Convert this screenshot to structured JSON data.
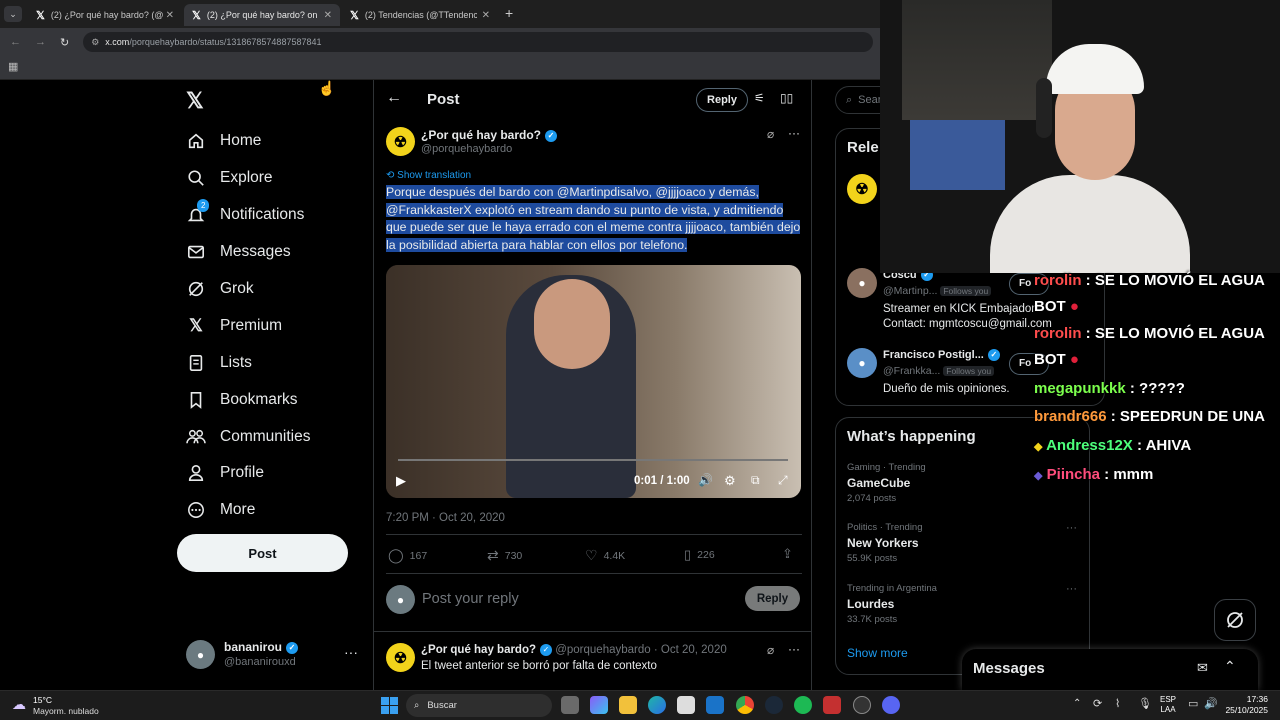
{
  "browser": {
    "tabs": [
      {
        "title": "(2) ¿Por qué hay bardo? (@porq",
        "active": false
      },
      {
        "title": "(2) ¿Por qué hay bardo? on X: \"",
        "active": true
      },
      {
        "title": "(2) Tendencias (@TTendenciaX)",
        "active": false
      }
    ],
    "url_domain": "x.com",
    "url_path": "/porquehaybardo/status/1318678574887587841"
  },
  "nav": {
    "items": [
      {
        "label": "Home",
        "icon": "home-icon"
      },
      {
        "label": "Explore",
        "icon": "search-icon"
      },
      {
        "label": "Notifications",
        "icon": "bell-icon",
        "badge": "2"
      },
      {
        "label": "Messages",
        "icon": "mail-icon"
      },
      {
        "label": "Grok",
        "icon": "grok-icon"
      },
      {
        "label": "Premium",
        "icon": "x-icon"
      },
      {
        "label": "Lists",
        "icon": "list-icon"
      },
      {
        "label": "Bookmarks",
        "icon": "bookmark-icon"
      },
      {
        "label": "Communities",
        "icon": "communities-icon"
      },
      {
        "label": "Profile",
        "icon": "person-icon"
      },
      {
        "label": "More",
        "icon": "more-circle-icon"
      }
    ],
    "post_label": "Post",
    "account": {
      "name": "bananirou",
      "handle": "@bananirouxd"
    }
  },
  "header": {
    "title": "Post",
    "reply_label": "Reply"
  },
  "tweet": {
    "author": "¿Por qué hay bardo?",
    "handle": "@porquehaybardo",
    "show_translation": "Show translation",
    "text": "Porque después del bardo con @Martinpdisalvo, @jjjjoaco y demás, @FrankkasterX explotó en stream dando su punto de vista, y admitiendo que puede ser que le haya errado con el meme contra jjjjoaco, también dejo la posibilidad abierta para hablar con ellos por telefono.",
    "video_time": "0:01 / 1:00",
    "timestamp": "7:20 PM · Oct 20, 2020",
    "stats": {
      "replies": "167",
      "reposts": "730",
      "likes": "4.4K",
      "bookmarks": "226"
    },
    "reply_placeholder": "Post your reply",
    "reply_button": "Reply"
  },
  "reply_tweet": {
    "author": "¿Por qué hay bardo?",
    "handle": "@porquehaybardo",
    "date": "· Oct 20, 2020",
    "text": "El tweet anterior se borró por falta de contexto"
  },
  "right": {
    "search_placeholder": "Sear",
    "relevant_title": "Rele",
    "people": [
      {
        "name": "Coscu",
        "handle": "@Martinp...",
        "follows": "Follows you",
        "follow_btn": "Fo",
        "bio": "Streamer en KICK Embajador",
        "bio2": "Contact: mgmtcoscu@gmail.com"
      },
      {
        "name": "Francisco Postigl...",
        "handle": "@Frankka...",
        "follows": "Follows you",
        "follow_btn": "Fo",
        "bio": "Dueño de mis opiniones."
      }
    ],
    "happening_title": "What’s happening",
    "trends": [
      {
        "category": "Gaming · Trending",
        "name": "GameCube",
        "count": "2,074 posts"
      },
      {
        "category": "Politics · Trending",
        "name": "New Yorkers",
        "count": "55.9K posts"
      },
      {
        "category": "Trending in Argentina",
        "name": "Lourdes",
        "count": "33.7K posts"
      }
    ],
    "show_more": "Show more",
    "messages_label": "Messages"
  },
  "chat": [
    {
      "user": "rorolin",
      "msg": "SE LO MOVIÓ EL AGUA",
      "color": "#ff4d4d"
    },
    {
      "user": "BOT",
      "msg": "",
      "color": "#ffffff"
    },
    {
      "user": "rorolin",
      "msg": "SE LO MOVIÓ EL AGUA",
      "color": "#ff4d4d"
    },
    {
      "user": "BOT",
      "msg": "",
      "color": "#ffffff"
    },
    {
      "user": "megapunkkk",
      "msg": "?????",
      "color": "#7cff4d"
    },
    {
      "user": "brandr666",
      "msg": "SPEEDRUN DE UNA",
      "color": "#ff9a3c"
    },
    {
      "user": "Andress12X",
      "msg": "AHIVA",
      "color": "#4dff7c"
    },
    {
      "user": "Piincha",
      "msg": "mmm",
      "color": "#ff4d7c"
    }
  ],
  "taskbar": {
    "weather_temp": "15°C",
    "weather_desc": "Mayorm. nublado",
    "search_label": "Buscar",
    "lang1": "ESP",
    "lang2": "LAA",
    "time": "17:36",
    "date": "25/10/2025"
  }
}
